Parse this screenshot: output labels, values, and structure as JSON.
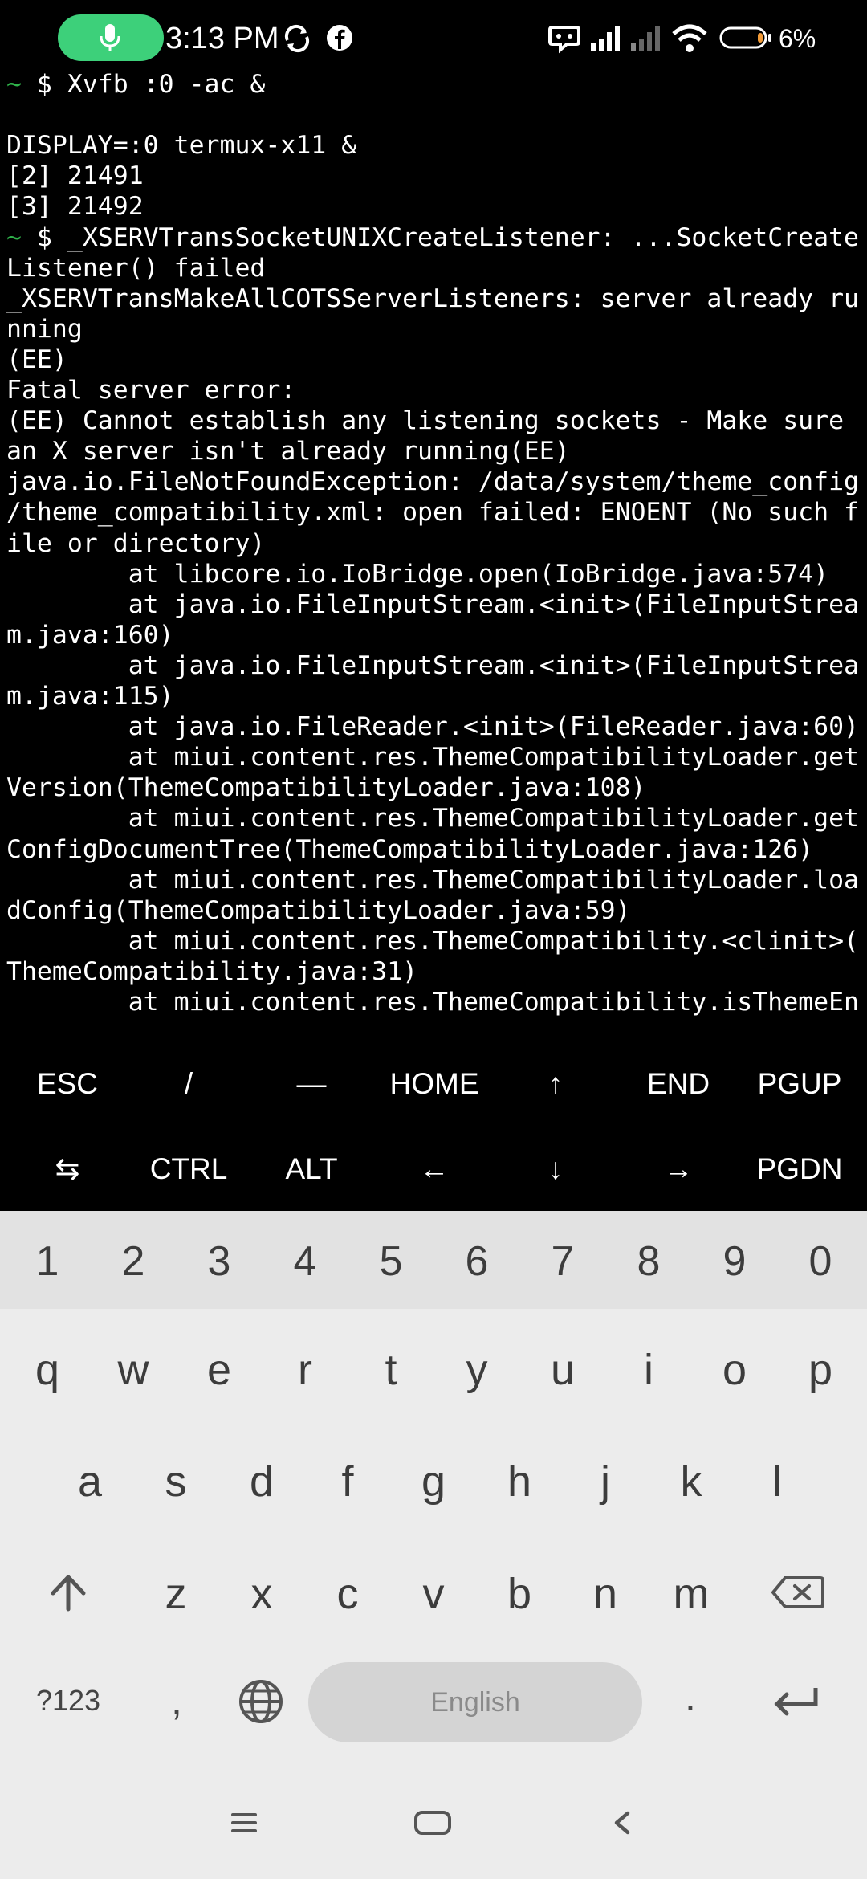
{
  "status_bar": {
    "time": "3:13 PM",
    "battery_percent": "6%",
    "icons": [
      "mic-icon",
      "sync-icon",
      "facebook-icon",
      "chat-icon",
      "signal-icon",
      "signal-weak-icon",
      "wifi-icon",
      "battery-icon"
    ],
    "mic_pill_color": "#3dd07a"
  },
  "terminal": {
    "prompt_color": "#2fb24a",
    "lines": [
      {
        "prefix": "~",
        "text": " $ Xvfb :0 -ac &"
      },
      {
        "prefix": "",
        "text": ""
      },
      {
        "prefix": "",
        "text": "DISPLAY=:0 termux-x11 &"
      },
      {
        "prefix": "",
        "text": "[2] 21491"
      },
      {
        "prefix": "",
        "text": "[3] 21492"
      },
      {
        "prefix": "~",
        "text": " $ _XSERVTransSocketUNIXCreateListener: ...SocketCreate"
      },
      {
        "prefix": "",
        "text": "Listener() failed"
      },
      {
        "prefix": "",
        "text": "_XSERVTransMakeAllCOTSServerListeners: server already ru"
      },
      {
        "prefix": "",
        "text": "nning"
      },
      {
        "prefix": "",
        "text": "(EE)"
      },
      {
        "prefix": "",
        "text": "Fatal server error:"
      },
      {
        "prefix": "",
        "text": "(EE) Cannot establish any listening sockets - Make sure"
      },
      {
        "prefix": "",
        "text": "an X server isn't already running(EE)"
      },
      {
        "prefix": "",
        "text": "java.io.FileNotFoundException: /data/system/theme_config"
      },
      {
        "prefix": "",
        "text": "/theme_compatibility.xml: open failed: ENOENT (No such f"
      },
      {
        "prefix": "",
        "text": "ile or directory)"
      },
      {
        "prefix": "",
        "text": "        at libcore.io.IoBridge.open(IoBridge.java:574)"
      },
      {
        "prefix": "",
        "text": "        at java.io.FileInputStream.<init>(FileInputStrea"
      },
      {
        "prefix": "",
        "text": "m.java:160)"
      },
      {
        "prefix": "",
        "text": "        at java.io.FileInputStream.<init>(FileInputStrea"
      },
      {
        "prefix": "",
        "text": "m.java:115)"
      },
      {
        "prefix": "",
        "text": "        at java.io.FileReader.<init>(FileReader.java:60)"
      },
      {
        "prefix": "",
        "text": "        at miui.content.res.ThemeCompatibilityLoader.get"
      },
      {
        "prefix": "",
        "text": "Version(ThemeCompatibilityLoader.java:108)"
      },
      {
        "prefix": "",
        "text": "        at miui.content.res.ThemeCompatibilityLoader.get"
      },
      {
        "prefix": "",
        "text": "ConfigDocumentTree(ThemeCompatibilityLoader.java:126)"
      },
      {
        "prefix": "",
        "text": "        at miui.content.res.ThemeCompatibilityLoader.loa"
      },
      {
        "prefix": "",
        "text": "dConfig(ThemeCompatibilityLoader.java:59)"
      },
      {
        "prefix": "",
        "text": "        at miui.content.res.ThemeCompatibility.<clinit>("
      },
      {
        "prefix": "",
        "text": "ThemeCompatibility.java:31)"
      },
      {
        "prefix": "",
        "text": "        at miui.content.res.ThemeCompatibility.isThemeEn"
      }
    ]
  },
  "extra_keys": {
    "row1": [
      "ESC",
      "/",
      "—",
      "HOME",
      "↑",
      "END",
      "PGUP"
    ],
    "row2": [
      "⇆",
      "CTRL",
      "ALT",
      "←",
      "↓",
      "→",
      "PGDN"
    ]
  },
  "keyboard": {
    "numbers": [
      "1",
      "2",
      "3",
      "4",
      "5",
      "6",
      "7",
      "8",
      "9",
      "0"
    ],
    "row1": [
      "q",
      "w",
      "e",
      "r",
      "t",
      "y",
      "u",
      "i",
      "o",
      "p"
    ],
    "row2": [
      "a",
      "s",
      "d",
      "f",
      "g",
      "h",
      "j",
      "k",
      "l"
    ],
    "row3": [
      "z",
      "x",
      "c",
      "v",
      "b",
      "n",
      "m"
    ],
    "symbols_label": "?123",
    "comma": ",",
    "period": ".",
    "space_label": "English",
    "background": "#ececec"
  },
  "nav_bar": {
    "icons": [
      "recents-icon",
      "home-icon",
      "back-icon"
    ]
  }
}
